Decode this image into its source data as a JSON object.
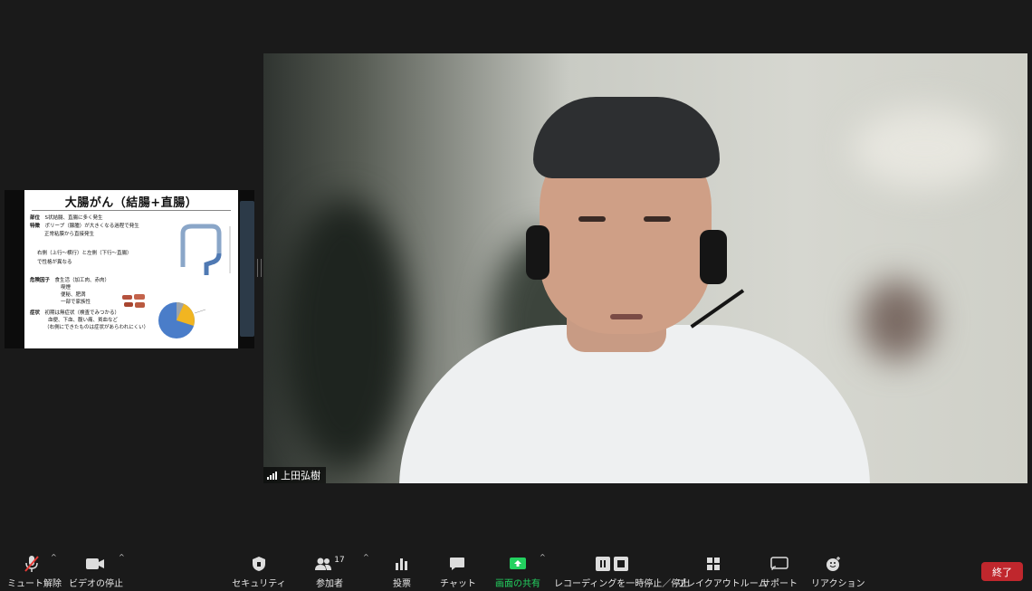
{
  "shared_screen": {
    "slide": {
      "title": "大腸がん（結腸+直腸）",
      "lines": [
        {
          "label": "部位",
          "text": "S状結腸、直腸に多く発生"
        },
        {
          "label": "特徴",
          "text": "ポリープ（腺腫）が大きくなる過程で発生"
        },
        {
          "label": "",
          "text": "正常粘膜から直接発生"
        },
        {
          "label": "",
          "text": "右側（上行〜横行）と左側（下行〜直腸）"
        },
        {
          "label": "",
          "text": "で性格が異なる"
        },
        {
          "label": "危険因子",
          "text": "食生活（加工肉、赤肉）"
        },
        {
          "label": "",
          "text": "喫煙"
        },
        {
          "label": "",
          "text": "便秘、肥満"
        },
        {
          "label": "",
          "text": "一部で家族性"
        },
        {
          "label": "症状",
          "text": "初期は無症状（検査でみつかる）"
        },
        {
          "label": "",
          "text": "血便、下血、腹い痛、貧血など"
        },
        {
          "label": "",
          "text": "（右側にできたものは症状があらわれにくい）"
        }
      ]
    }
  },
  "video": {
    "participant_name": "上田弘樹"
  },
  "toolbar": {
    "mute": "ミュート解除",
    "video": "ビデオの停止",
    "security": "セキュリティ",
    "participants": "参加者",
    "participants_count": "17",
    "polls": "投票",
    "chat": "チャット",
    "share": "画面の共有",
    "recording": "レコーディングを一時停止／停止",
    "breakout": "ブレイクアウトルーム",
    "support": "サポート",
    "reactions": "リアクション",
    "end": "終了",
    "share_color": "#23d160",
    "end_color": "#c0272d"
  }
}
